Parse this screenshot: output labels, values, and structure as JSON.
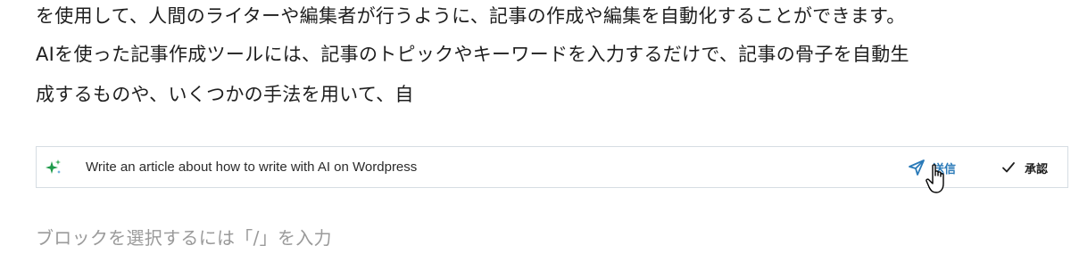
{
  "article": {
    "lines": [
      "を使用して、人間のライターや編集者が行うように、記事の作成や編集を自動化することができます。",
      "AIを使った記事作成ツールには、記事のトピックやキーワードを入力するだけで、記事の骨子を自動生",
      "成するものや、いくつかの手法を用いて、自"
    ]
  },
  "ai_bar": {
    "icon": "sparkle-icon",
    "accent_color": "#2a7ab8",
    "prompt_value": "Write an article about how to write with AI on Wordpress",
    "send_label": "送信",
    "accept_label": "承認"
  },
  "editor": {
    "block_placeholder": "ブロックを選択するには「/」を入力"
  }
}
